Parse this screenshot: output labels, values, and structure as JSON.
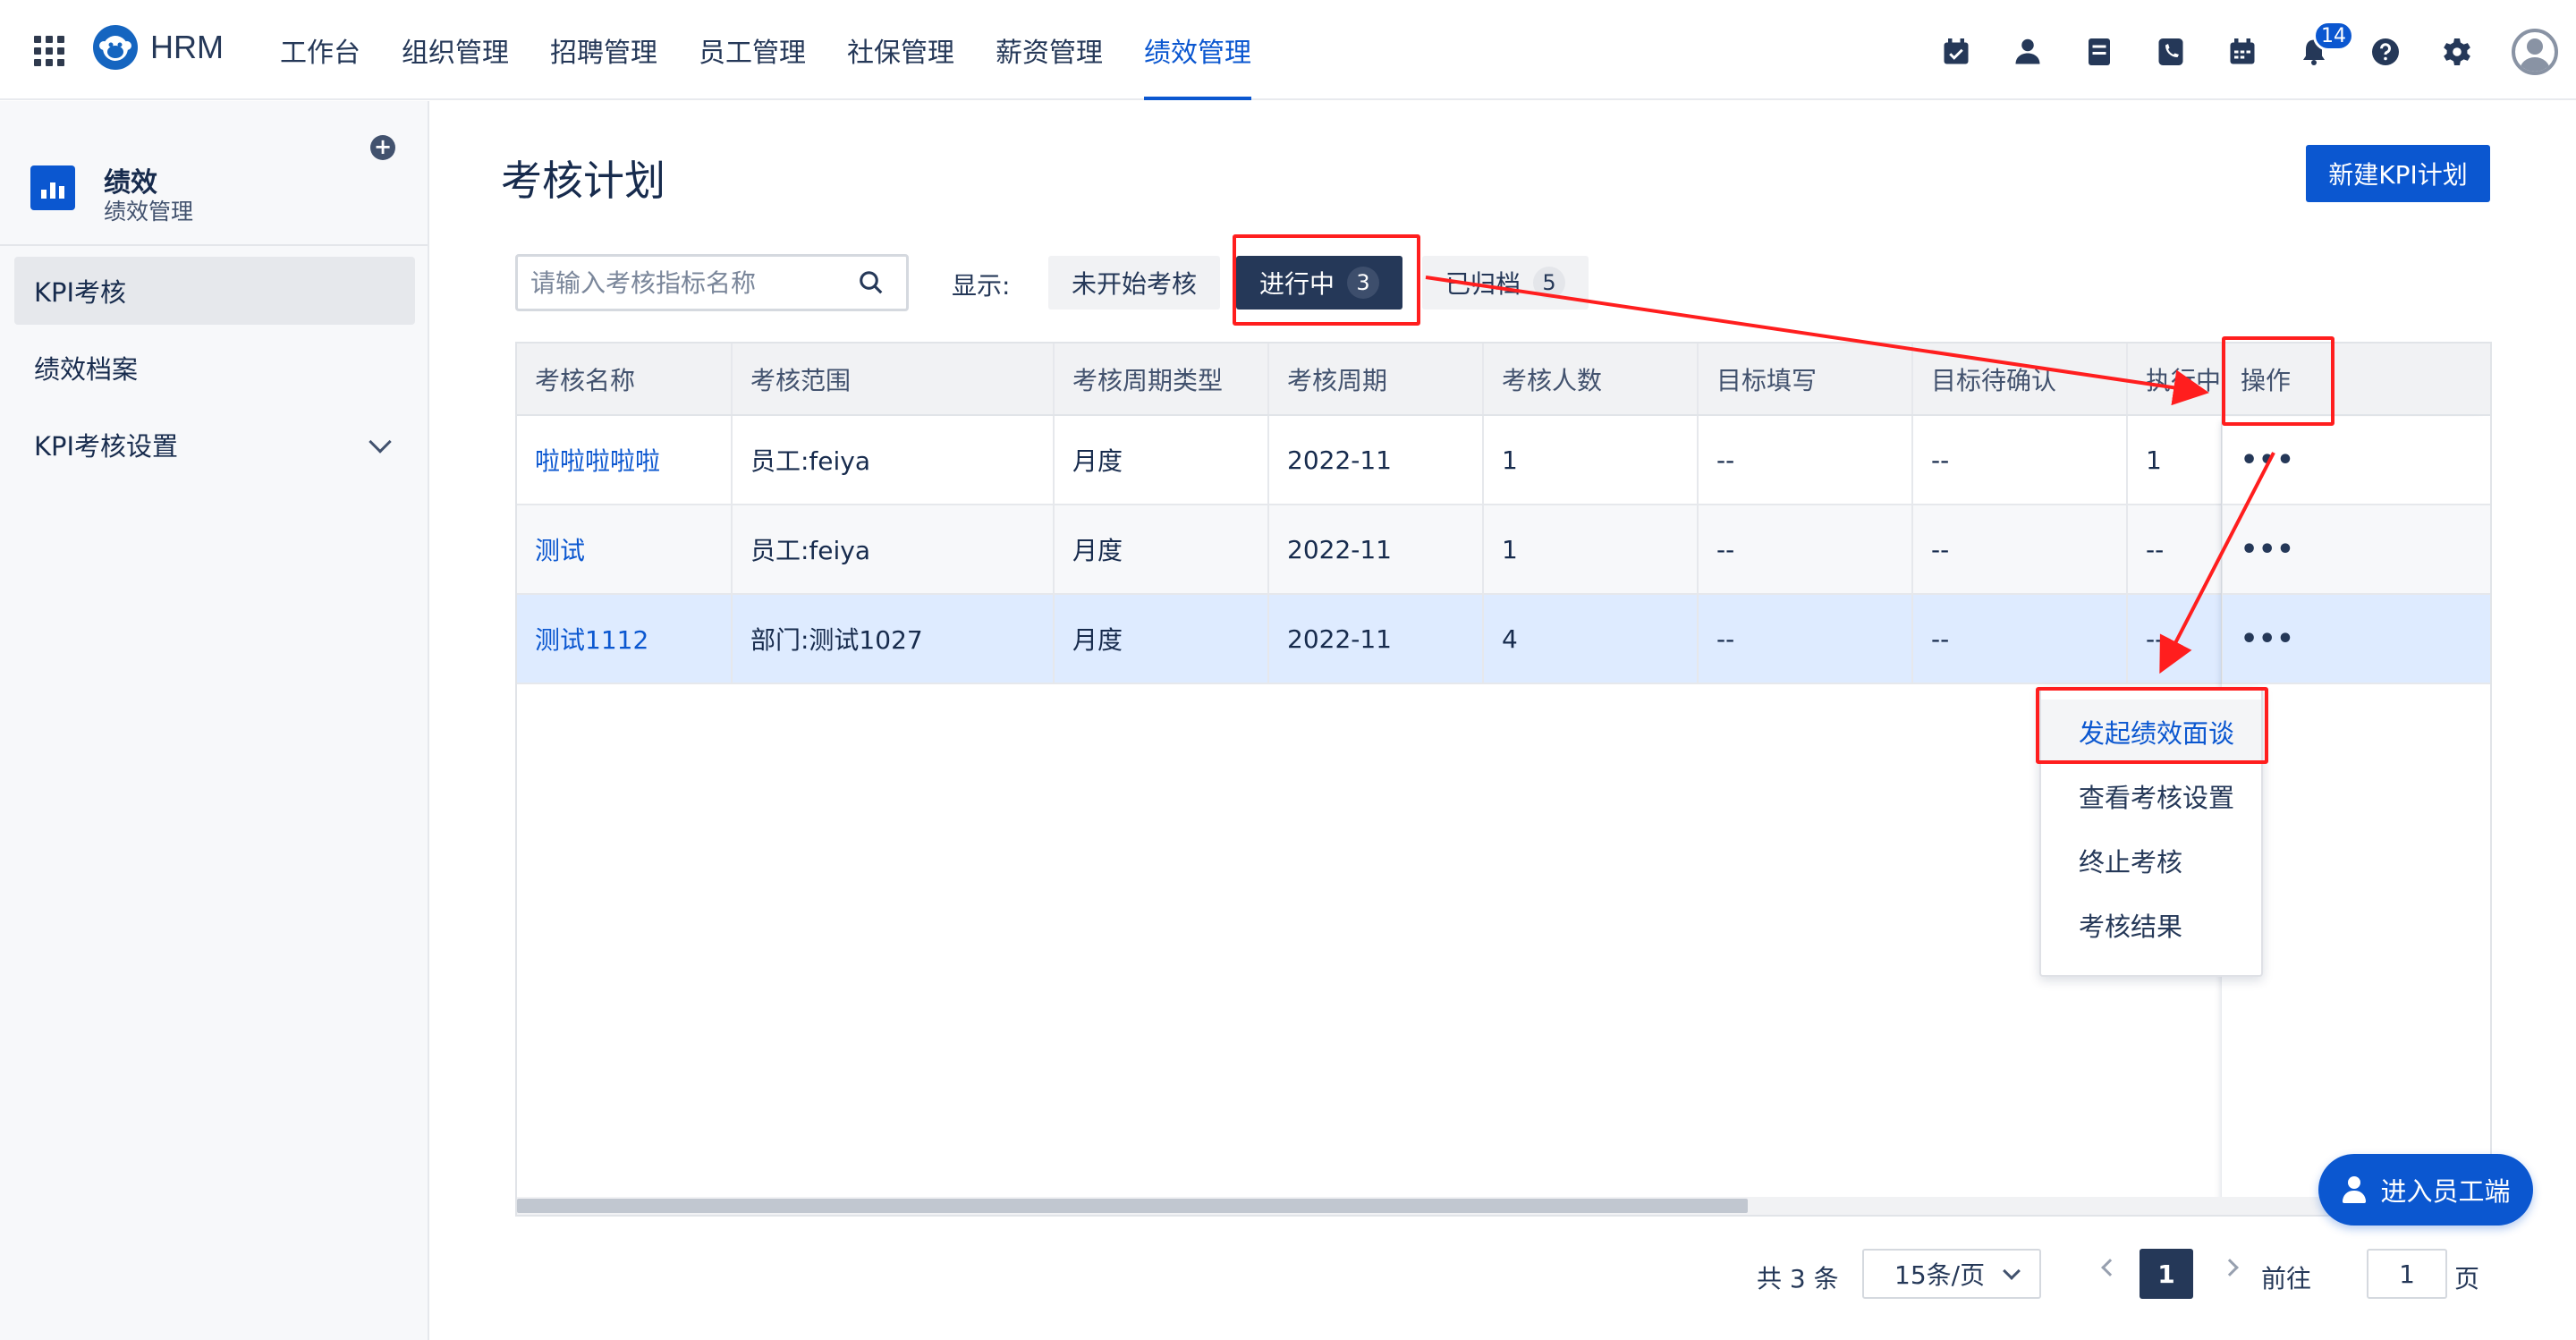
{
  "header": {
    "brand": "HRM",
    "nav": [
      "工作台",
      "组织管理",
      "招聘管理",
      "员工管理",
      "社保管理",
      "薪资管理",
      "绩效管理"
    ],
    "active_nav": 6,
    "notification_count": "14",
    "icons": [
      "calendar-check-icon",
      "user-icon",
      "document-icon",
      "phone-icon",
      "calendar-icon",
      "bell-icon",
      "help-icon",
      "gear-icon",
      "avatar-icon"
    ]
  },
  "sidebar": {
    "title": "绩效",
    "subtitle": "绩效管理",
    "items": [
      {
        "label": "KPI考核"
      },
      {
        "label": "绩效档案"
      },
      {
        "label": "KPI考核设置"
      }
    ]
  },
  "main": {
    "title": "考核计划",
    "new_button": "新建KPI计划",
    "search_placeholder": "请输入考核指标名称",
    "show_label": "显示:",
    "filters": [
      {
        "label": "未开始考核",
        "count": ""
      },
      {
        "label": "进行中",
        "count": "3"
      },
      {
        "label": "已归档",
        "count": "5"
      }
    ]
  },
  "table": {
    "columns": [
      "考核名称",
      "考核范围",
      "考核周期类型",
      "考核周期",
      "考核人数",
      "目标填写",
      "目标待确认",
      "执行中",
      "操作"
    ],
    "rows": [
      [
        "啦啦啦啦啦",
        "员工:feiya",
        "月度",
        "2022-11",
        "1",
        "--",
        "--",
        "1"
      ],
      [
        "测试",
        "员工:feiya",
        "月度",
        "2022-11",
        "1",
        "--",
        "--",
        "--"
      ],
      [
        "测试1112",
        "部门:测试1027",
        "月度",
        "2022-11",
        "4",
        "--",
        "--",
        "--"
      ]
    ],
    "more_label": "•••"
  },
  "dropdown": {
    "items": [
      "发起绩效面谈",
      "查看考核设置",
      "终止考核",
      "考核结果"
    ]
  },
  "fab_label": "进入员工端",
  "pagination": {
    "total": "共 3 条",
    "page_size": "15条/页",
    "current": "1",
    "goto_label": "前往",
    "goto_value": "1",
    "page_unit": "页"
  },
  "colors": {
    "primary": "#0b57d0",
    "dark": "#253858",
    "annotation": "#ff1e1e",
    "highlight_row": "#deebff"
  }
}
